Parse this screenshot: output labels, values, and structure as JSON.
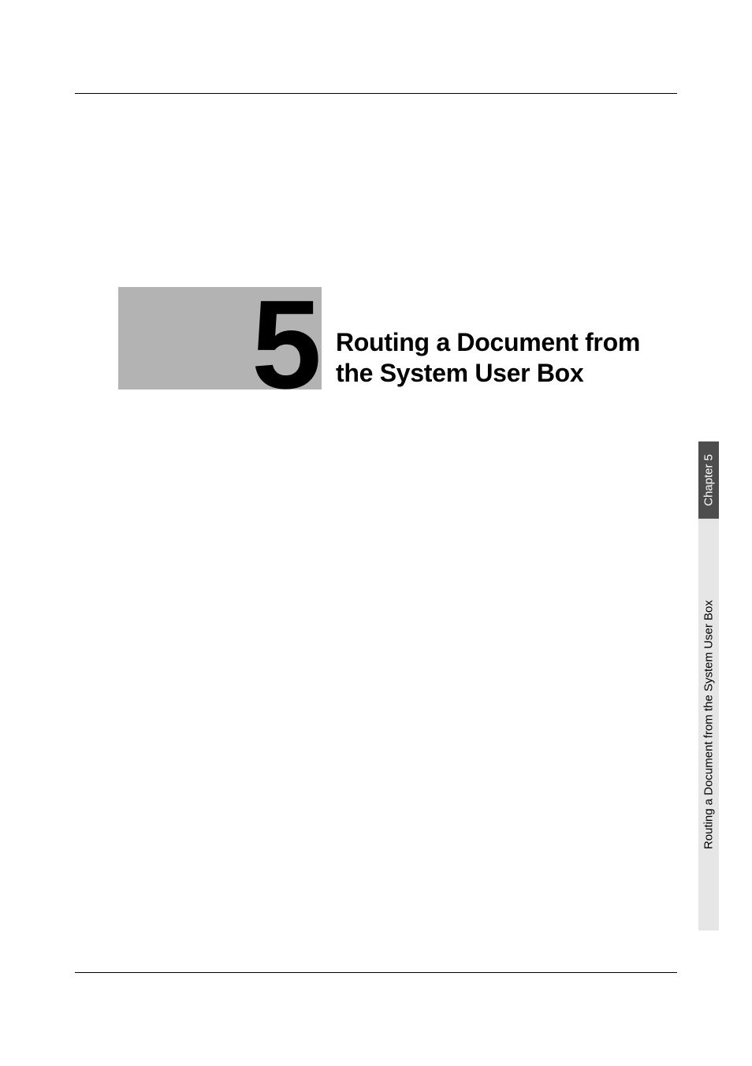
{
  "chapter": {
    "number": "5",
    "title": "Routing a Document from the System User Box"
  },
  "side_tab": {
    "chapter_label": "Chapter 5",
    "section_label": "Routing a Document from the System User Box"
  }
}
